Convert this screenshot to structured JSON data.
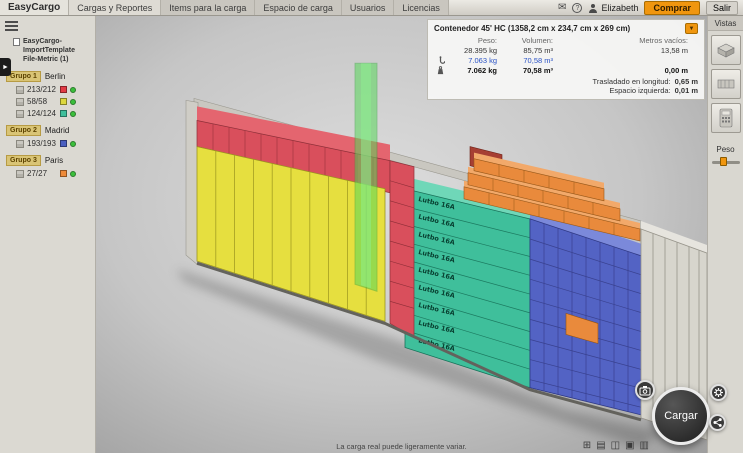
{
  "header": {
    "logo": "EasyCargo",
    "tabs": [
      "Cargas y Reportes",
      "Items para la carga",
      "Espacio de carga",
      "Usuarios",
      "Licencias"
    ],
    "user": "Elizabeth",
    "buy": "Comprar",
    "exit": "Salir"
  },
  "sidebar": {
    "project_line1": "EasyCargo-ImportTemplate",
    "project_line2": "File-Metric (1)",
    "status_color": "#3bbf3b",
    "groups": [
      {
        "name": "Grupo 1",
        "destination": "Berlin",
        "items": [
          {
            "count": "213/212",
            "color": "#e23b45"
          },
          {
            "count": "58/58",
            "color": "#ddd83e"
          },
          {
            "count": "124/124",
            "color": "#3fbf9b"
          }
        ]
      },
      {
        "name": "Grupo 2",
        "destination": "Madrid",
        "items": [
          {
            "count": "193/193",
            "color": "#4a5fc0"
          }
        ]
      },
      {
        "name": "Grupo 3",
        "destination": "Paris",
        "items": [
          {
            "count": "27/27",
            "color": "#ee8b3a"
          }
        ]
      }
    ]
  },
  "info_panel": {
    "title": "Contenedor 45' HC (1358,2 cm x 234,7 cm x 269 cm)",
    "headers": {
      "peso": "Peso:",
      "volumen": "Volumen:",
      "metros": "Metros vacíos:"
    },
    "rows": [
      {
        "peso": "28.395 kg",
        "volumen": "85,75 m³",
        "metros": "13,58 m"
      },
      {
        "peso": "7.063 kg",
        "volumen": "70,58 m³",
        "metros": ""
      },
      {
        "peso": "7.062 kg",
        "volumen": "70,58 m³",
        "metros": "0,00 m"
      }
    ],
    "extras": [
      {
        "label": "Trasladado en longitud:",
        "value": "0,65 m"
      },
      {
        "label": "Espacio izquierda:",
        "value": "0,01 m"
      }
    ]
  },
  "views_panel": {
    "title": "Vistas",
    "weight_label": "Peso"
  },
  "scene": {
    "box_label": "Lutbo 16A",
    "disclaimer": "La carga real puede ligeramente variar.",
    "load_button": "Cargar",
    "colors": {
      "red": "#d94f5c",
      "yellow": "#e6df3f",
      "teal": "#3fbf9b",
      "blue": "#5363c4",
      "orange": "#e98a3c",
      "drop_beam": "#58d75a"
    },
    "tools": [
      {
        "glyph": "⊞"
      },
      {
        "glyph": "▤"
      },
      {
        "glyph": "◫"
      },
      {
        "glyph": "▣"
      },
      {
        "glyph": "▥"
      }
    ]
  }
}
